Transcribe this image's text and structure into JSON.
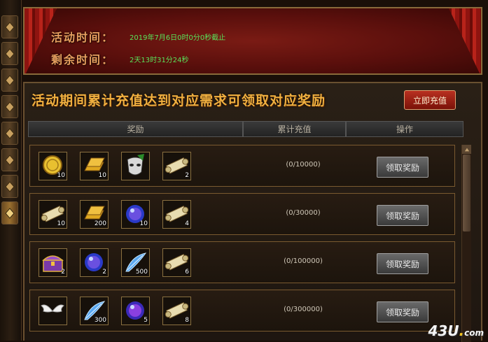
{
  "banner": {
    "activity_time_label": "活动时间：",
    "activity_time_value": "2019年7月6日0时0分0秒截止",
    "remaining_time_label": "剩余时间：",
    "remaining_time_value": "2天13时31分24秒"
  },
  "panel": {
    "title": "活动期间累计充值达到对应需求可领取对应奖励",
    "recharge_button": "立即充值",
    "columns": [
      "奖励",
      "累计充值",
      "操作"
    ]
  },
  "rows": [
    {
      "progress": "(0/10000)",
      "claim_label": "领取奖励",
      "items": [
        {
          "icon": "gold-coin-icon",
          "qty": "10"
        },
        {
          "icon": "gold-bar-icon",
          "qty": "10"
        },
        {
          "icon": "mask-icon",
          "qty": ""
        },
        {
          "icon": "scroll-icon",
          "qty": "2"
        }
      ]
    },
    {
      "progress": "(0/30000)",
      "claim_label": "领取奖励",
      "items": [
        {
          "icon": "scroll-icon",
          "qty": "10"
        },
        {
          "icon": "gold-bar-icon",
          "qty": "200"
        },
        {
          "icon": "blue-orb-icon",
          "qty": "10"
        },
        {
          "icon": "scroll-icon",
          "qty": "4"
        }
      ]
    },
    {
      "progress": "(0/100000)",
      "claim_label": "领取奖励",
      "items": [
        {
          "icon": "treasure-chest-icon",
          "qty": "2"
        },
        {
          "icon": "blue-orb-icon",
          "qty": "2"
        },
        {
          "icon": "blue-feather-icon",
          "qty": "500"
        },
        {
          "icon": "scroll-icon",
          "qty": "6"
        }
      ]
    },
    {
      "progress": "(0/300000)",
      "claim_label": "领取奖励",
      "items": [
        {
          "icon": "wings-icon",
          "qty": ""
        },
        {
          "icon": "blue-feather-icon",
          "qty": "300"
        },
        {
          "icon": "god-orb-icon",
          "qty": "5"
        },
        {
          "icon": "scroll-icon",
          "qty": "8"
        }
      ]
    }
  ],
  "watermark": {
    "main": "43U",
    "dot": ".",
    "suffix": "com"
  },
  "colors": {
    "accent_gold": "#f0b040",
    "time_green": "#59e35a",
    "banner_red": "#7a1b14"
  }
}
